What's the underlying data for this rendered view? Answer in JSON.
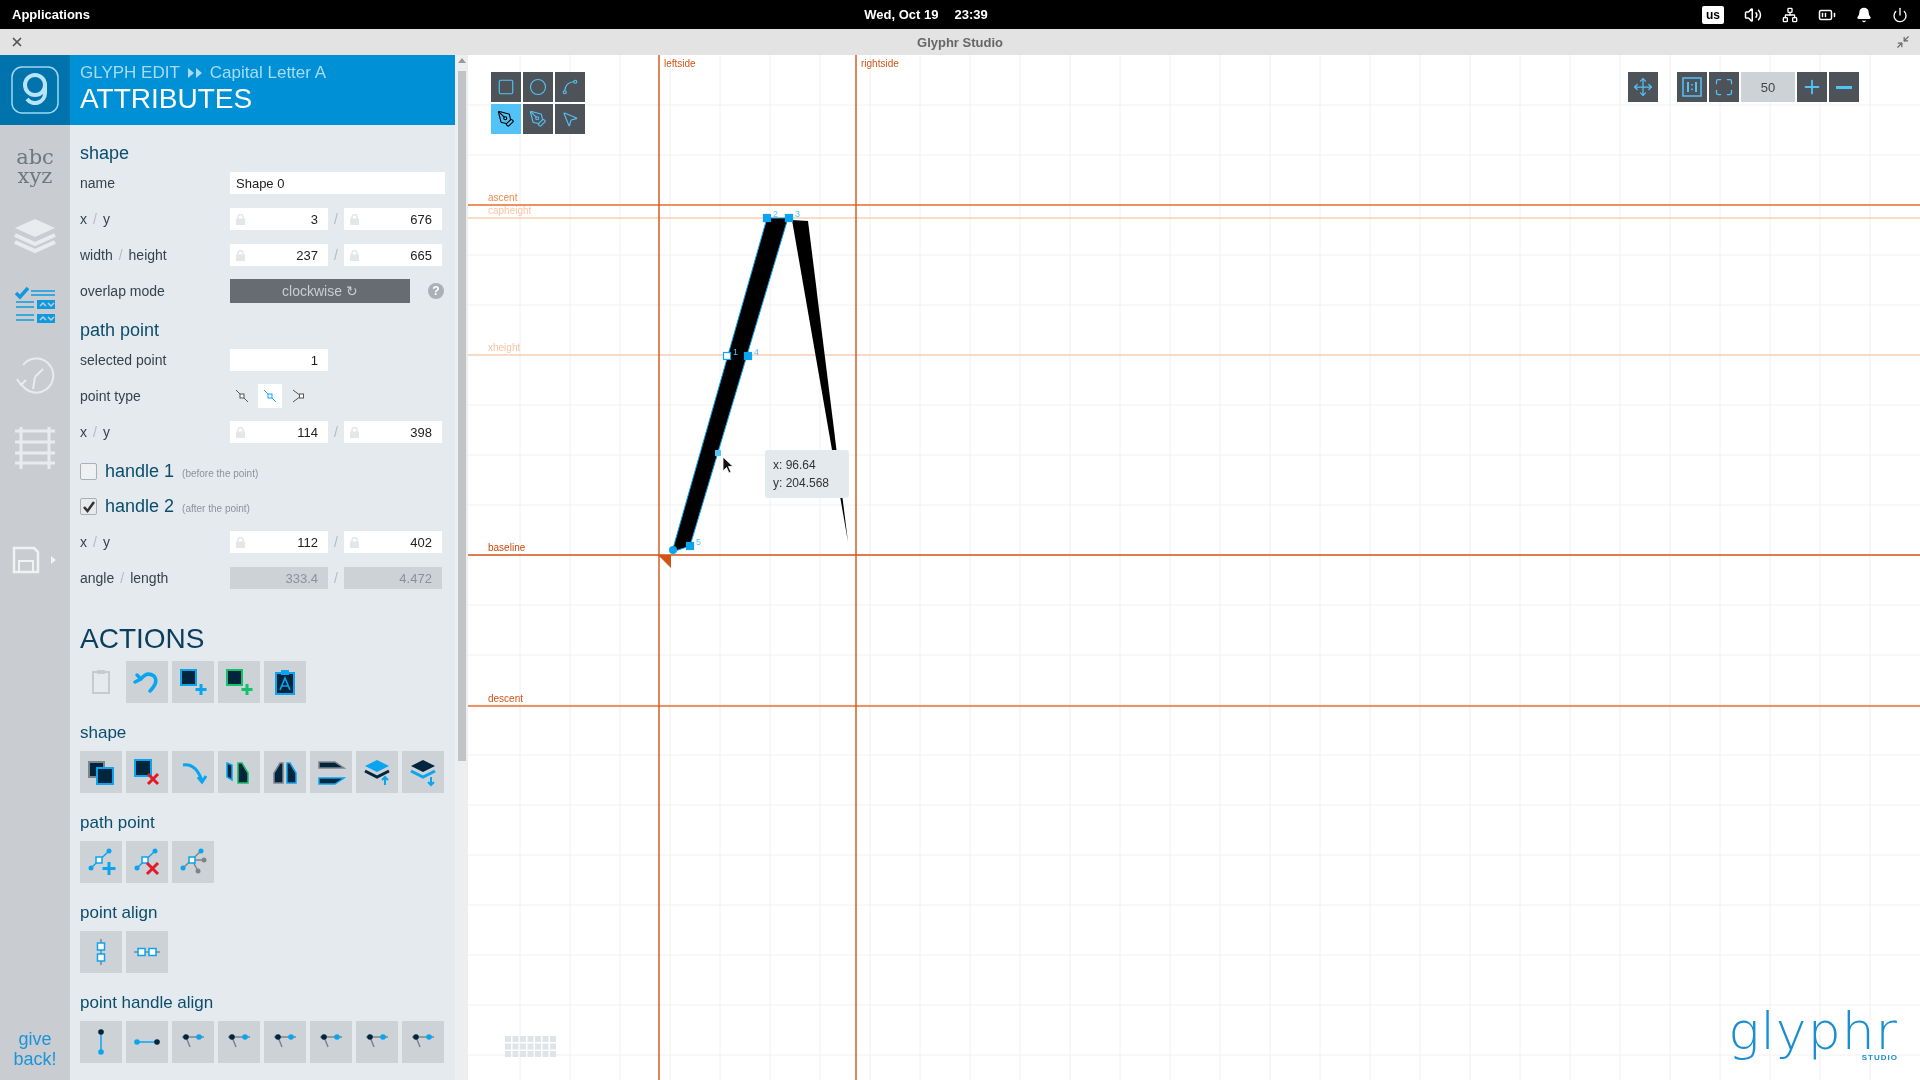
{
  "top_bar": {
    "menu": "Applications",
    "date": "Wed, Oct 19",
    "time": "23:39",
    "keyboard_layout": "us"
  },
  "window": {
    "title": "Glyphr Studio"
  },
  "nav": {
    "items": [
      {
        "kind": "glyphs",
        "text": "abc xyz",
        "selected": false
      },
      {
        "kind": "layers",
        "selected": false
      },
      {
        "kind": "attributes",
        "selected": true
      },
      {
        "kind": "history",
        "selected": false
      },
      {
        "kind": "guides",
        "selected": false
      }
    ],
    "give_back": "give back!"
  },
  "header": {
    "mode": "GLYPH EDIT",
    "glyph": "Capital Letter A",
    "title": "ATTRIBUTES"
  },
  "sections": [
    {
      "heading": "shape",
      "rows": [
        {
          "kind": "text",
          "label": "name",
          "value": "Shape 0"
        },
        {
          "kind": "pair",
          "label_a": "x",
          "label_sep": "/",
          "label_b": "y",
          "value_a": "3",
          "value_sep": "/",
          "value_b": "676",
          "disabled": false
        },
        {
          "kind": "pair",
          "label_a": "width",
          "label_sep": "/",
          "label_b": "height",
          "value_a": "237",
          "value_sep": "/",
          "value_b": "665",
          "disabled": false
        },
        {
          "kind": "toggle",
          "label": "overlap mode",
          "value": "clockwise",
          "icon": "↻",
          "help": "?"
        }
      ]
    },
    {
      "heading": "path point",
      "rows": [
        {
          "kind": "single",
          "label": "selected point",
          "value": "1"
        },
        {
          "kind": "point_type",
          "label": "point type",
          "options": [
            {
              "selected": false
            },
            {
              "selected": true
            },
            {
              "selected": false
            }
          ]
        },
        {
          "kind": "pair",
          "label_a": "x",
          "label_sep": "/",
          "label_b": "y",
          "value_a": "114",
          "value_sep": "/",
          "value_b": "398",
          "disabled": false
        },
        {
          "kind": "handle",
          "label": "handle 1",
          "note": "(before the point)",
          "checked": false
        },
        {
          "kind": "handle",
          "label": "handle 2",
          "note": "(after the point)",
          "checked": true
        },
        {
          "kind": "pair",
          "label_a": "x",
          "label_sep": "/",
          "label_b": "y",
          "value_a": "112",
          "value_sep": "/",
          "value_b": "402",
          "disabled": false
        },
        {
          "kind": "pair",
          "label_a": "angle",
          "label_sep": "/",
          "label_b": "length",
          "value_a": "333.4",
          "value_sep": "/",
          "value_b": "4.472",
          "disabled": true
        }
      ]
    }
  ],
  "actions": {
    "heading": "ACTIONS",
    "groups": [
      {
        "buttons": [
          {
            "kind": "paste",
            "disabled": true
          },
          {
            "kind": "undo",
            "disabled": false
          },
          {
            "kind": "add_shape",
            "disabled": false
          },
          {
            "kind": "add_component",
            "disabled": false
          },
          {
            "kind": "paste_glyph",
            "disabled": false
          }
        ]
      },
      {
        "heading": "shape",
        "buttons": [
          {
            "kind": "copy_shape",
            "disabled": false
          },
          {
            "kind": "delete_shape",
            "disabled": false
          },
          {
            "kind": "reverse",
            "disabled": false
          },
          {
            "kind": "flip_h",
            "disabled": false
          },
          {
            "kind": "flip_h2",
            "disabled": false
          },
          {
            "kind": "flip_v",
            "disabled": false
          },
          {
            "kind": "move_up",
            "disabled": false
          },
          {
            "kind": "move_down",
            "disabled": false
          }
        ]
      },
      {
        "heading": "path point",
        "buttons": [
          {
            "kind": "insert_point",
            "disabled": false
          },
          {
            "kind": "delete_point",
            "disabled": false
          },
          {
            "kind": "reset_handles",
            "disabled": false
          }
        ]
      },
      {
        "heading": "point align",
        "buttons": [
          {
            "kind": "align_v",
            "disabled": false
          },
          {
            "kind": "align_h",
            "disabled": false
          }
        ]
      },
      {
        "heading": "point handle align",
        "buttons": [
          {
            "kind": "handle_v",
            "disabled": false
          },
          {
            "kind": "handle_h",
            "disabled": false
          },
          {
            "kind": "handle_pair",
            "disabled": false
          },
          {
            "kind": "handle_pair",
            "disabled": false
          },
          {
            "kind": "handle_pair",
            "disabled": false
          },
          {
            "kind": "handle_pair",
            "disabled": false
          },
          {
            "kind": "handle_pair",
            "disabled": false
          },
          {
            "kind": "handle_pair",
            "disabled": false
          }
        ]
      }
    ]
  },
  "canvas": {
    "tools": [
      {
        "kind": "rect",
        "selected": false
      },
      {
        "kind": "oval",
        "selected": false
      },
      {
        "kind": "path",
        "selected": false
      },
      {
        "kind": "pen_add",
        "selected": true
      },
      {
        "kind": "pen",
        "selected": false
      },
      {
        "kind": "pointer",
        "selected": false
      }
    ],
    "zoom": "50",
    "guides": [
      {
        "kind": "ascent",
        "label": "ascent"
      },
      {
        "kind": "capheight",
        "label": "capheight"
      },
      {
        "kind": "xheight",
        "label": "xheight"
      },
      {
        "kind": "baseline",
        "label": "baseline"
      },
      {
        "kind": "descent",
        "label": "descent"
      },
      {
        "kind": "leftside",
        "label": "leftside"
      },
      {
        "kind": "rightside",
        "label": "rightside"
      }
    ],
    "point_labels": [
      "1",
      "2",
      "3",
      "4",
      "5"
    ],
    "tooltip": [
      "x: 96.64",
      "y: 204.568"
    ],
    "logo": {
      "word": "glyphr",
      "sub": "STUDIO"
    }
  }
}
